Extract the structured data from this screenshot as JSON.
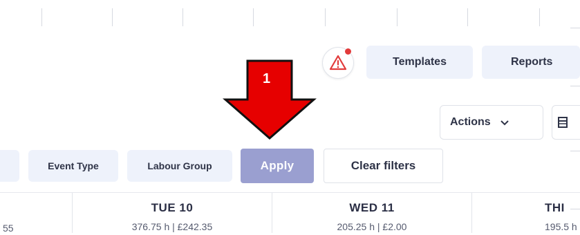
{
  "header": {
    "templates_label": "Templates",
    "reports_label": "Reports"
  },
  "toolbar": {
    "actions_label": "Actions"
  },
  "filters": {
    "event_type_label": "Event Type",
    "labour_group_label": "Labour Group",
    "apply_label": "Apply",
    "clear_label": "Clear filters"
  },
  "annotation": {
    "step_number": "1"
  },
  "days": [
    {
      "name": "TUE 10",
      "summary": "376.75 h | £242.35"
    },
    {
      "name": "WED 11",
      "summary": "205.25 h | £2.00"
    },
    {
      "name": "THI",
      "summary": "195.5 h"
    }
  ],
  "edge_value": "55",
  "colors": {
    "apply_bg": "#9a9fd0",
    "pill_bg": "#eef2fb",
    "arrow_red": "#e60000",
    "alert_red": "#e23b3b"
  },
  "icons": {
    "alert": "warning-triangle-icon",
    "actions_dropdown": "chevron-down-icon",
    "calendar": "calendar-icon"
  }
}
